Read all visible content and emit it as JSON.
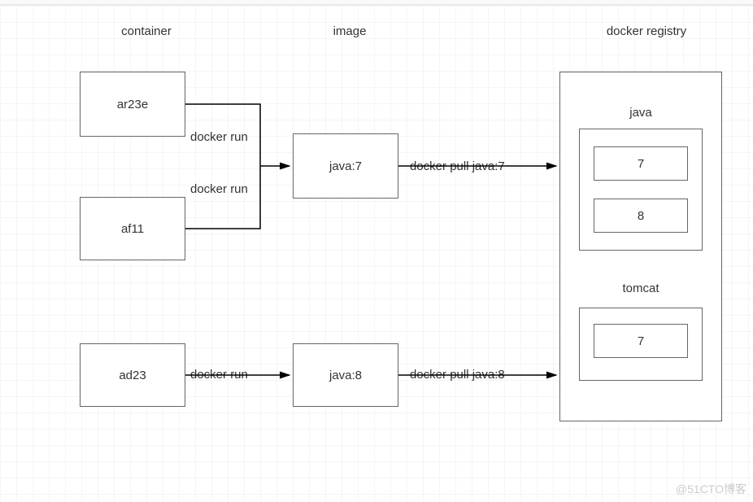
{
  "columns": {
    "container": "container",
    "image": "image",
    "registry": "docker registry"
  },
  "containers": {
    "c1": "ar23e",
    "c2": "af11",
    "c3": "ad23"
  },
  "images": {
    "i1": "java:7",
    "i2": "java:8"
  },
  "edges": {
    "run1": "docker run",
    "run2": "docker run",
    "run3": "docker run",
    "pull1": "docker pull java:7",
    "pull2": "docker pull java:8"
  },
  "registry": {
    "repo1": {
      "name": "java",
      "tags": [
        "7",
        "8"
      ]
    },
    "repo2": {
      "name": "tomcat",
      "tags": [
        "7"
      ]
    }
  },
  "watermark": "@51CTO博客"
}
